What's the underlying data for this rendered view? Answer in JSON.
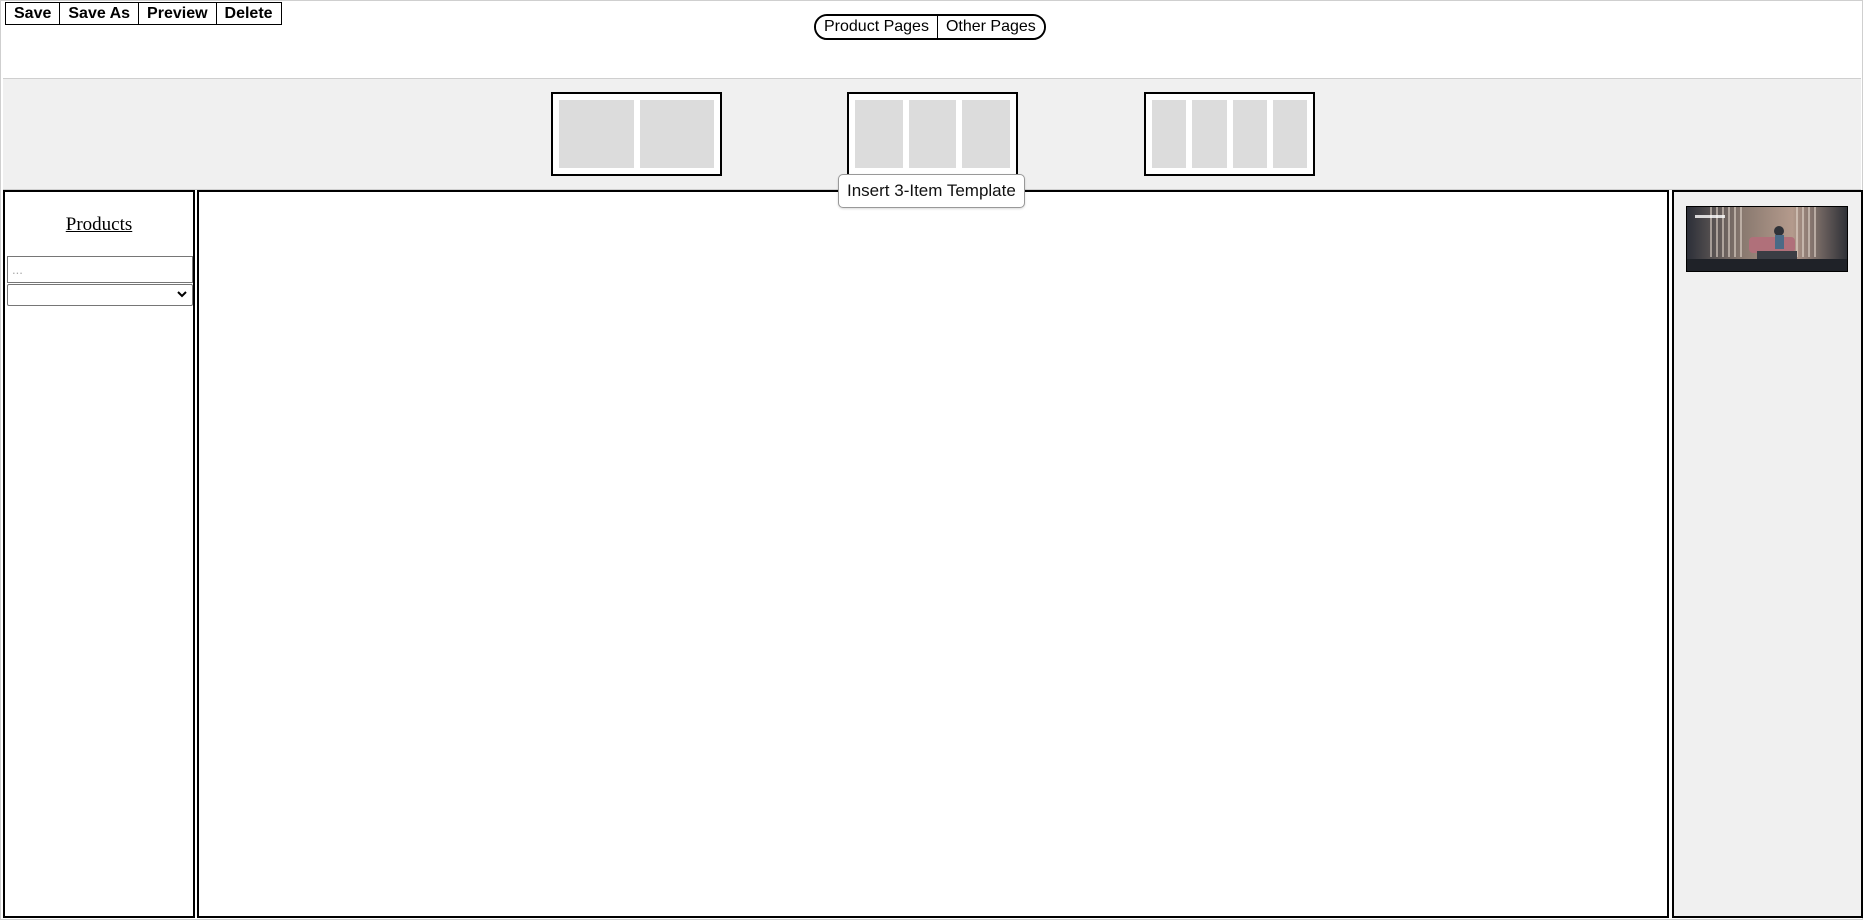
{
  "toolbar": {
    "save_label": "Save",
    "save_as_label": "Save As",
    "preview_label": "Preview",
    "delete_label": "Delete"
  },
  "page_toggle": {
    "product_pages_label": "Product Pages",
    "other_pages_label": "Other Pages"
  },
  "templates": [
    {
      "name": "2-item",
      "cells": 2
    },
    {
      "name": "3-item",
      "cells": 3
    },
    {
      "name": "4-item",
      "cells": 4
    }
  ],
  "tooltip": {
    "text": "Insert 3-Item Template"
  },
  "left_panel": {
    "products_link": "Products",
    "search_placeholder": "...",
    "select_value": ""
  },
  "right_panel": {
    "thumbnail_icon": "image-thumbnail"
  },
  "colors": {
    "template_bar_bg": "#f0f0f0",
    "template_cell": "#dcdcdc",
    "right_panel_bg": "#f0f0f0"
  }
}
